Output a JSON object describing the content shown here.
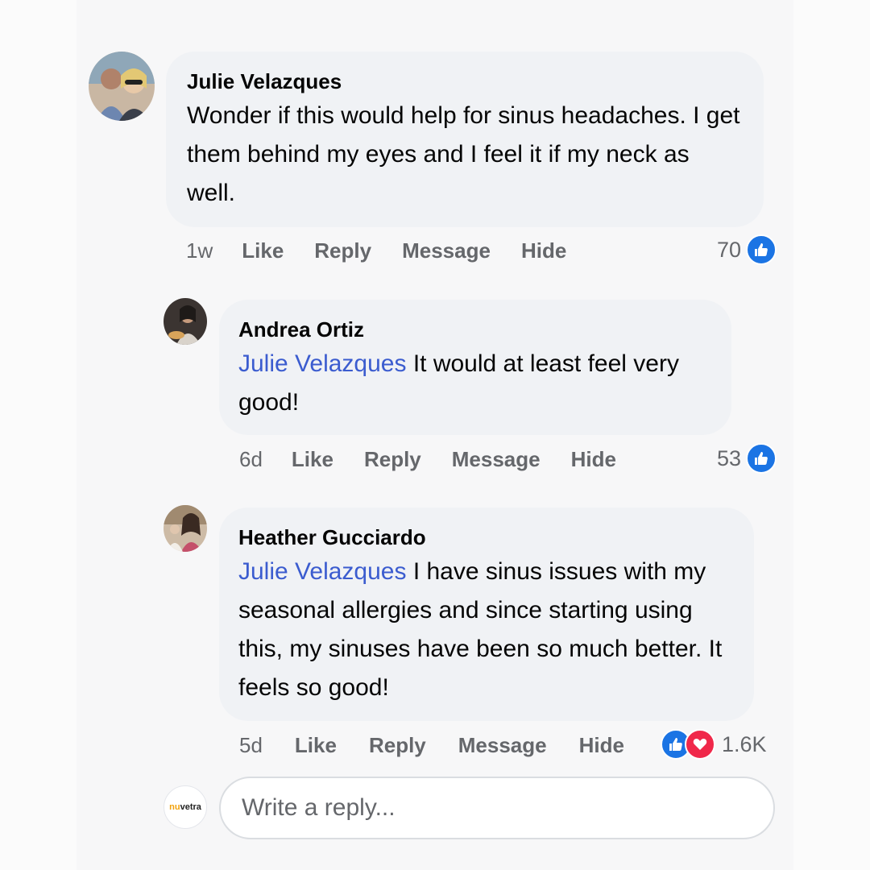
{
  "comments": [
    {
      "author": "Julie Velazques",
      "mention": "",
      "text": "Wonder if this would help for sinus headaches. I get them behind my eyes and I feel it if my neck as well.",
      "time": "1w",
      "reaction_count": "70"
    },
    {
      "author": "Andrea Ortiz",
      "mention": "Julie Velazques",
      "text": " It would at least feel very good!",
      "time": "6d",
      "reaction_count": "53"
    },
    {
      "author": "Heather Gucciardo",
      "mention": "Julie Velazques",
      "text": " I have sinus issues with my seasonal allergies and since starting using this, my sinuses have been so much better. It feels so good!",
      "time": "5d",
      "reaction_count": "1.6K"
    }
  ],
  "actions": {
    "like": "Like",
    "reply": "Reply",
    "message": "Message",
    "hide": "Hide"
  },
  "reply_box": {
    "placeholder": "Write a reply..."
  },
  "page_avatar": {
    "logo_prefix": "nu",
    "logo_text": "vetra"
  },
  "icons": {
    "like": "thumbs-up-icon",
    "love": "heart-icon"
  },
  "colors": {
    "mention": "#3b5ccf",
    "like_blue": "#1b74e4",
    "love_red": "#f0284a",
    "bubble": "#f0f2f5",
    "secondary_text": "#65676b"
  }
}
